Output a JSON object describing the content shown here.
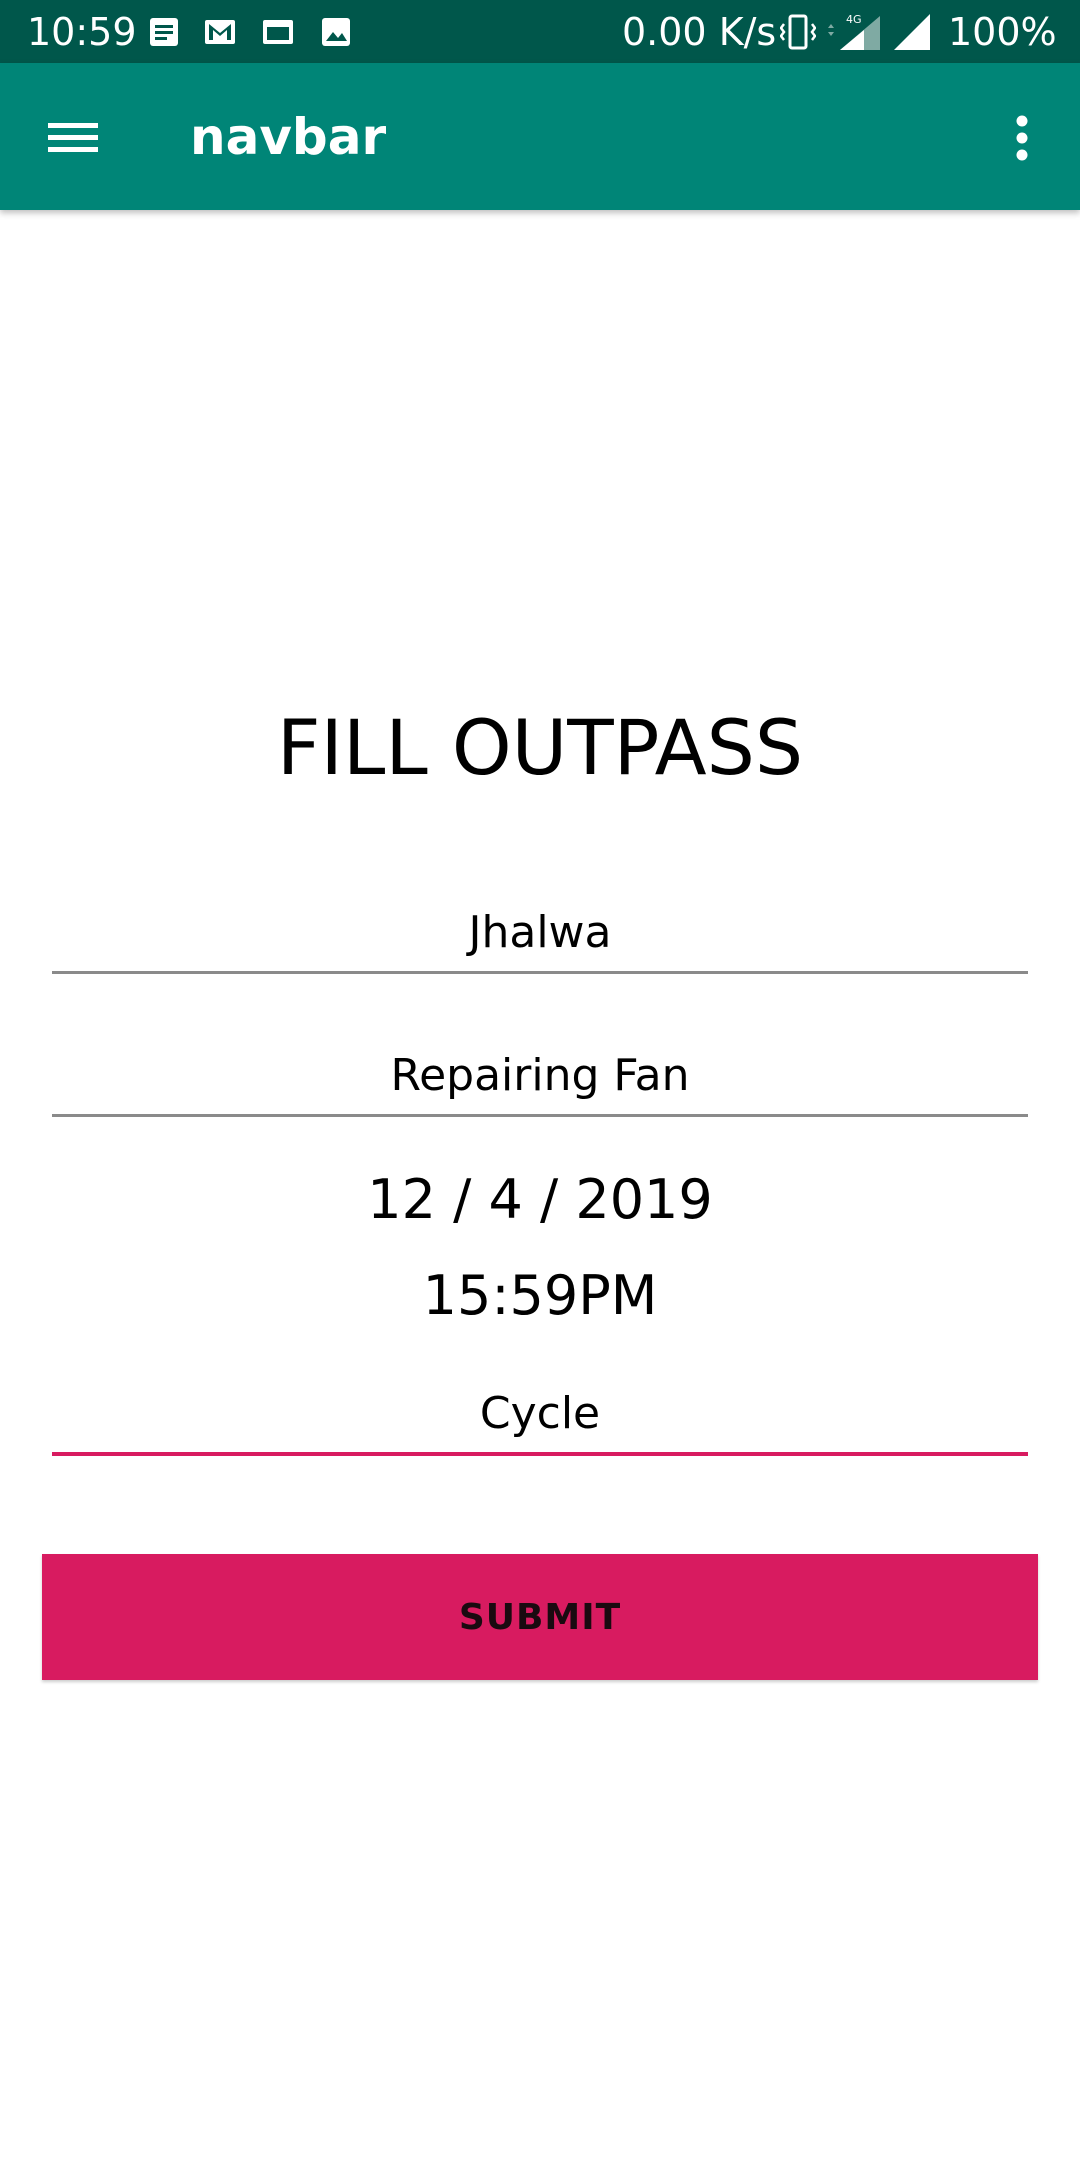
{
  "status_bar": {
    "time": "10:59",
    "network_speed": "0.00 K/s",
    "network_type": "4G",
    "battery": "100%",
    "notification_icons": [
      "document-icon",
      "gmail-icon",
      "window-icon",
      "image-icon"
    ]
  },
  "app_bar": {
    "title": "navbar",
    "color": "#008577",
    "status_color": "#00574b"
  },
  "form": {
    "heading": "FILL OUTPASS",
    "place": "Jhalwa",
    "purpose": "Repairing Fan",
    "date": "12 / 4 / 2019",
    "time": "15:59PM",
    "vehicle": "Cycle",
    "submit_label": "SUBMIT",
    "accent_color": "#d81b60"
  }
}
